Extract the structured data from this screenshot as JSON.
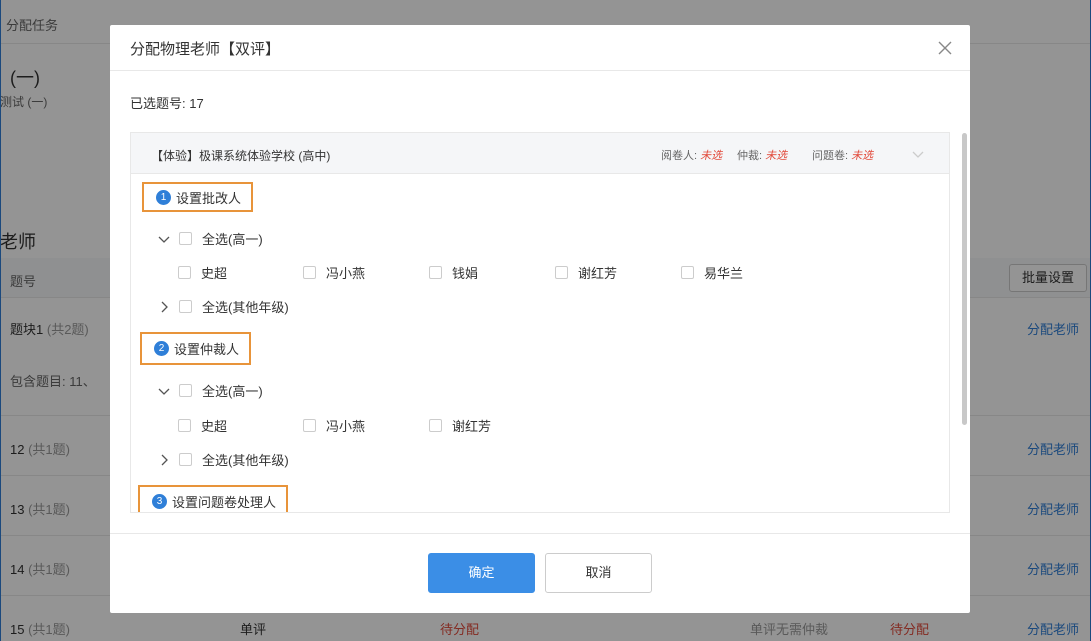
{
  "background": {
    "breadcrumb": "分配任务",
    "title": "(一)",
    "subtitle": "测试 (一)",
    "section_title": "老师",
    "table_header": "题号",
    "batch_button": "批量设置",
    "rows": [
      {
        "name": "题块1",
        "count": "(共2题)",
        "assign": "分配老师"
      },
      {
        "sub": "包含题目: 11、"
      },
      {
        "name": "12",
        "count": "(共1题)",
        "assign": "分配老师"
      },
      {
        "name": "13",
        "count": "(共1题)",
        "assign": "分配老师"
      },
      {
        "name": "14",
        "count": "(共1题)",
        "assign": "分配老师"
      },
      {
        "name": "15",
        "count": "(共1题)",
        "mode": "单评",
        "status": "待分配",
        "note": "单评无需仲裁",
        "status2": "待分配",
        "assign": "分配老师"
      }
    ]
  },
  "modal": {
    "title": "分配物理老师【双评】",
    "selected_label": "已选题号:",
    "selected_value": "17",
    "school": "【体验】极课系统体验学校 (高中)",
    "stats": [
      {
        "label": "阅卷人:",
        "value": "未选"
      },
      {
        "label": "仲裁:",
        "value": "未选"
      },
      {
        "label": "问题卷:",
        "value": "未选"
      }
    ],
    "steps": [
      {
        "num": "1",
        "label": "设置批改人"
      },
      {
        "num": "2",
        "label": "设置仲裁人"
      },
      {
        "num": "3",
        "label": "设置问题卷处理人"
      }
    ],
    "group_high1": "全选(高一)",
    "group_other": "全选(其他年级)",
    "graders": [
      "史超",
      "冯小燕",
      "钱娟",
      "谢红芳",
      "易华兰"
    ],
    "arbiters": [
      "史超",
      "冯小燕",
      "谢红芳"
    ],
    "confirm": "确定",
    "cancel": "取消"
  }
}
